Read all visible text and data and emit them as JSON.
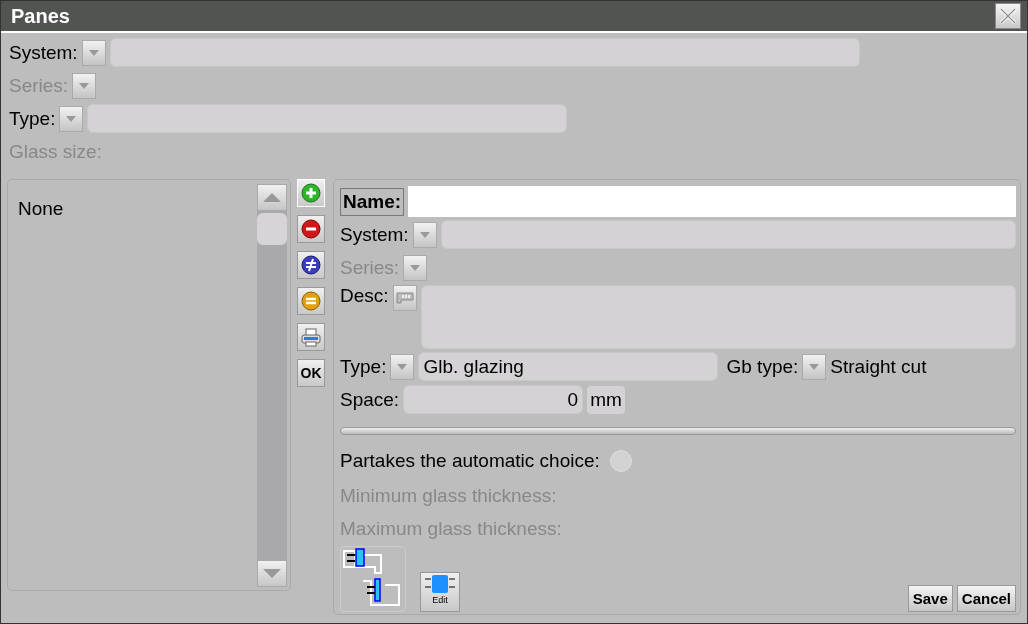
{
  "window": {
    "title": "Panes"
  },
  "filters": [
    {
      "label": "System:",
      "disabled": false,
      "kind": "combo_field"
    },
    {
      "label": "Series:",
      "disabled": true,
      "kind": "combo"
    },
    {
      "label": "Type:",
      "disabled": false,
      "kind": "combo_field"
    },
    {
      "label": "Glass size:",
      "disabled": true,
      "kind": "label"
    }
  ],
  "list": {
    "items": [
      {
        "label": "None",
        "selected": false
      }
    ]
  },
  "toolbar": [
    {
      "kind": "add"
    },
    {
      "kind": "remove"
    },
    {
      "kind": "differ"
    },
    {
      "kind": "equal"
    },
    {
      "kind": "print"
    },
    {
      "kind": "text",
      "label": "OK"
    }
  ],
  "form": {
    "name_label": "Name:",
    "system": {
      "label": "System:",
      "disabled": false
    },
    "series": {
      "label": "Series:",
      "disabled": true
    },
    "desc": {
      "label": "Desc:"
    },
    "type": {
      "label": "Type:",
      "value": "Glb. glazing"
    },
    "gb_type": {
      "label": "Gb type:",
      "value": "Straight cut"
    },
    "space": {
      "label": "Space:",
      "value": "0",
      "unit": "mm"
    },
    "partakes": {
      "label": "Partakes the automatic choice:",
      "checked": false
    },
    "thickness": [
      {
        "label": "Minimum glass thickness:",
        "disabled": true
      },
      {
        "label": "Maximum glass thickness:",
        "disabled": true
      }
    ],
    "edit_button": "Edit"
  },
  "buttons": [
    "Save",
    "Cancel"
  ]
}
